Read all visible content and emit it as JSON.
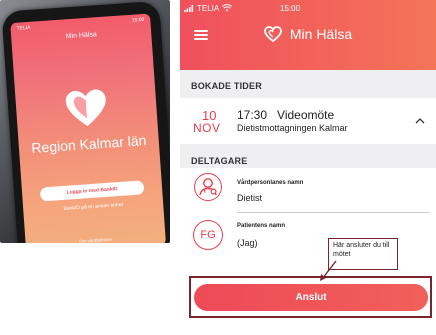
{
  "photo": {
    "app_title": "Min Hälsa",
    "region_name": "Region Kalmar län",
    "login_button": "Logga in med BankID",
    "alt_login": "BankID på en annan enhet",
    "footer": "Om vårdtjänsten"
  },
  "status_bar": {
    "carrier": "TELIA",
    "time": "15:00"
  },
  "header": {
    "title": "Min Hälsa"
  },
  "sections": {
    "bokade_tider": "BOKADE TIDER",
    "deltagare": "DELTAGARE"
  },
  "booking": {
    "day": "10",
    "month": "NOV",
    "time": "17:30",
    "type": "Videomöte",
    "location": "Dietistmottagningen Kalmar"
  },
  "participants": [
    {
      "label": "Vårdpersonlanes namn",
      "value": "Dietist",
      "avatar_icon": "person-icon"
    },
    {
      "label": "Patientens namn",
      "value": "(Jag)",
      "initials": "FG"
    }
  ],
  "callout": {
    "text": "Här ansluter du till mötet"
  },
  "actions": {
    "connect_label": "Anslut"
  },
  "colors": {
    "brand": "#f0505c",
    "accent_red": "#e8404c",
    "callout_border": "#7a2430",
    "section_bg": "#efeff2"
  }
}
